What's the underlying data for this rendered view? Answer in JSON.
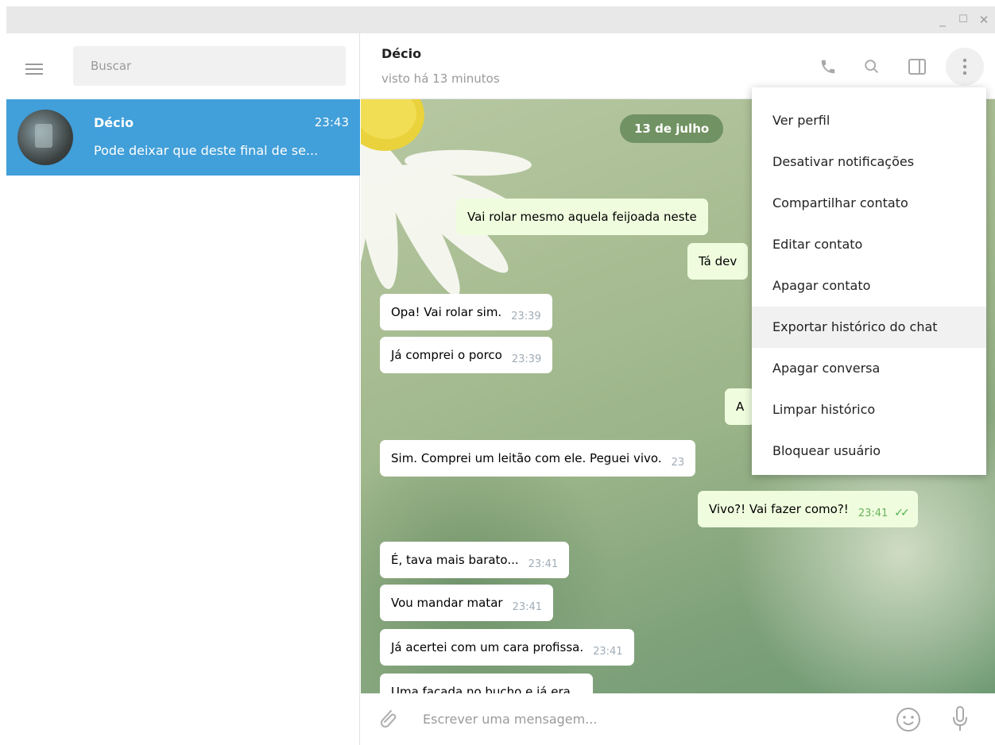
{
  "window": {
    "minimize_icon": "minimize-icon",
    "maximize_icon": "maximize-icon",
    "close_icon": "close-icon"
  },
  "sidebar": {
    "search_placeholder": "Buscar",
    "dialogs": [
      {
        "name": "Décio",
        "time": "23:43",
        "preview": "Pode deixar que deste final de se..."
      }
    ]
  },
  "header": {
    "name": "Décio",
    "status": "visto há 13 minutos"
  },
  "chat": {
    "date": "13 de julho",
    "messages": [
      {
        "dir": "out",
        "text": "Vai rolar mesmo aquela feijoada neste",
        "time": ""
      },
      {
        "dir": "out",
        "text": "Tá dev",
        "time": ""
      },
      {
        "dir": "in",
        "text": "Opa! Vai rolar sim.",
        "time": "23:39"
      },
      {
        "dir": "in",
        "text": "Já comprei o porco",
        "time": "23:39"
      },
      {
        "dir": "out",
        "text": "A",
        "time": ""
      },
      {
        "dir": "in",
        "text": "Sim. Comprei um leitão com ele. Peguei vivo.",
        "time": "23"
      },
      {
        "dir": "out",
        "text": "Vivo?! Vai fazer como?!",
        "time": "23:41"
      },
      {
        "dir": "in",
        "text": "É, tava mais barato...",
        "time": "23:41"
      },
      {
        "dir": "in",
        "text": "Vou mandar matar",
        "time": "23:41"
      },
      {
        "dir": "in",
        "text": "Já acertei com um cara profissa.",
        "time": "23:41"
      },
      {
        "dir": "in",
        "text": "Uma facada no bucho e já era...",
        "time": ""
      }
    ]
  },
  "composer": {
    "placeholder": "Escrever uma mensagem..."
  },
  "menu": {
    "items": [
      "Ver perfil",
      "Desativar notificações",
      "Compartilhar contato",
      "Editar contato",
      "Apagar contato",
      "Exportar histórico do chat",
      "Apagar conversa",
      "Limpar histórico",
      "Bloquear usuário"
    ],
    "highlighted_index": 5
  },
  "colors": {
    "accent": "#419fd9",
    "out_bubble": "#effdde",
    "read_ticks": "#4dae4a"
  }
}
